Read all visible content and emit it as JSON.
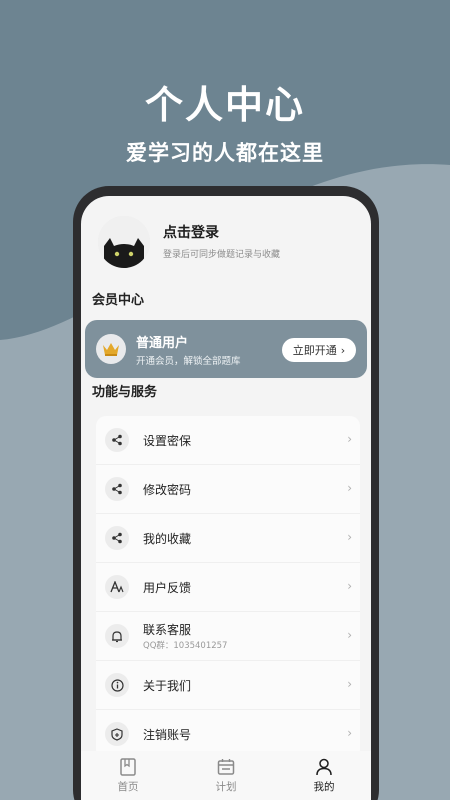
{
  "hero": {
    "title": "个人中心",
    "subtitle": "爱学习的人都在这里"
  },
  "profile": {
    "login_title": "点击登录",
    "login_hint": "登录后可同步做题记录与收藏"
  },
  "membership": {
    "section_title": "会员中心",
    "plan_name": "普通用户",
    "plan_desc": "开通会员，解锁全部题库",
    "cta_label": "立即开通",
    "cta_chevron": "›"
  },
  "services": {
    "section_title": "功能与服务",
    "chevron": "›",
    "items": [
      {
        "label": "设置密保",
        "icon": "share-icon"
      },
      {
        "label": "修改密码",
        "icon": "share-icon"
      },
      {
        "label": "我的收藏",
        "icon": "share-icon"
      },
      {
        "label": "用户反馈",
        "icon": "font-icon"
      },
      {
        "label": "联系客服",
        "sub": "QQ群：1035401257",
        "icon": "bell-icon"
      },
      {
        "label": "关于我们",
        "icon": "info-icon"
      },
      {
        "label": "注销账号",
        "icon": "shield-icon"
      }
    ]
  },
  "tabbar": {
    "tabs": [
      {
        "label": "首页",
        "icon": "book-icon",
        "active": false
      },
      {
        "label": "计划",
        "icon": "calendar-icon",
        "active": false
      },
      {
        "label": "我的",
        "icon": "user-icon",
        "active": true
      }
    ]
  },
  "colors": {
    "background": "#6d8491",
    "vip_card": "#7f919c",
    "phone_frame": "#2d2d2f"
  }
}
